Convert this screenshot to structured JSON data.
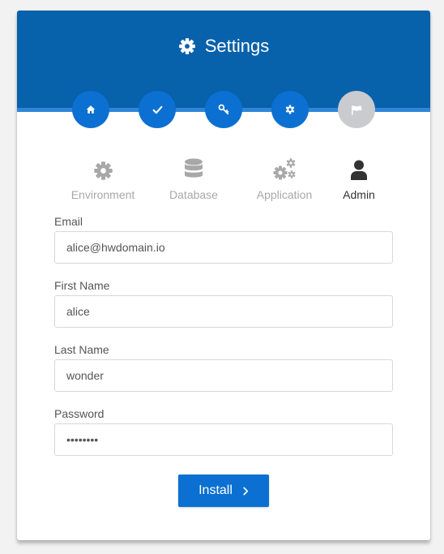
{
  "header": {
    "title": "Settings",
    "title_icon": "gear-icon",
    "background_color": "#0761ab"
  },
  "steps": [
    {
      "icon": "home-icon",
      "status": "complete"
    },
    {
      "icon": "check-icon",
      "status": "complete"
    },
    {
      "icon": "key-icon",
      "status": "complete"
    },
    {
      "icon": "gear-icon",
      "status": "complete"
    },
    {
      "icon": "flag-icon",
      "status": "pending"
    }
  ],
  "tabs": [
    {
      "label": "Environment",
      "icon": "gear-icon",
      "active": false
    },
    {
      "label": "Database",
      "icon": "database-icon",
      "active": false
    },
    {
      "label": "Application",
      "icon": "gears-icon",
      "active": false
    },
    {
      "label": "Admin",
      "icon": "user-icon",
      "active": true
    }
  ],
  "form": {
    "email": {
      "label": "Email",
      "value": "alice@hwdomain.io"
    },
    "first_name": {
      "label": "First Name",
      "value": "alice"
    },
    "last_name": {
      "label": "Last Name",
      "value": "wonder"
    },
    "password": {
      "label": "Password",
      "value": "password"
    }
  },
  "install_button": {
    "label": "Install",
    "icon": "chevron-right-icon"
  },
  "colors": {
    "accent": "#0b70d1",
    "inactive_step": "#c9cbce",
    "inactive_tab": "#a8a8a8",
    "active_tab": "#333333"
  }
}
